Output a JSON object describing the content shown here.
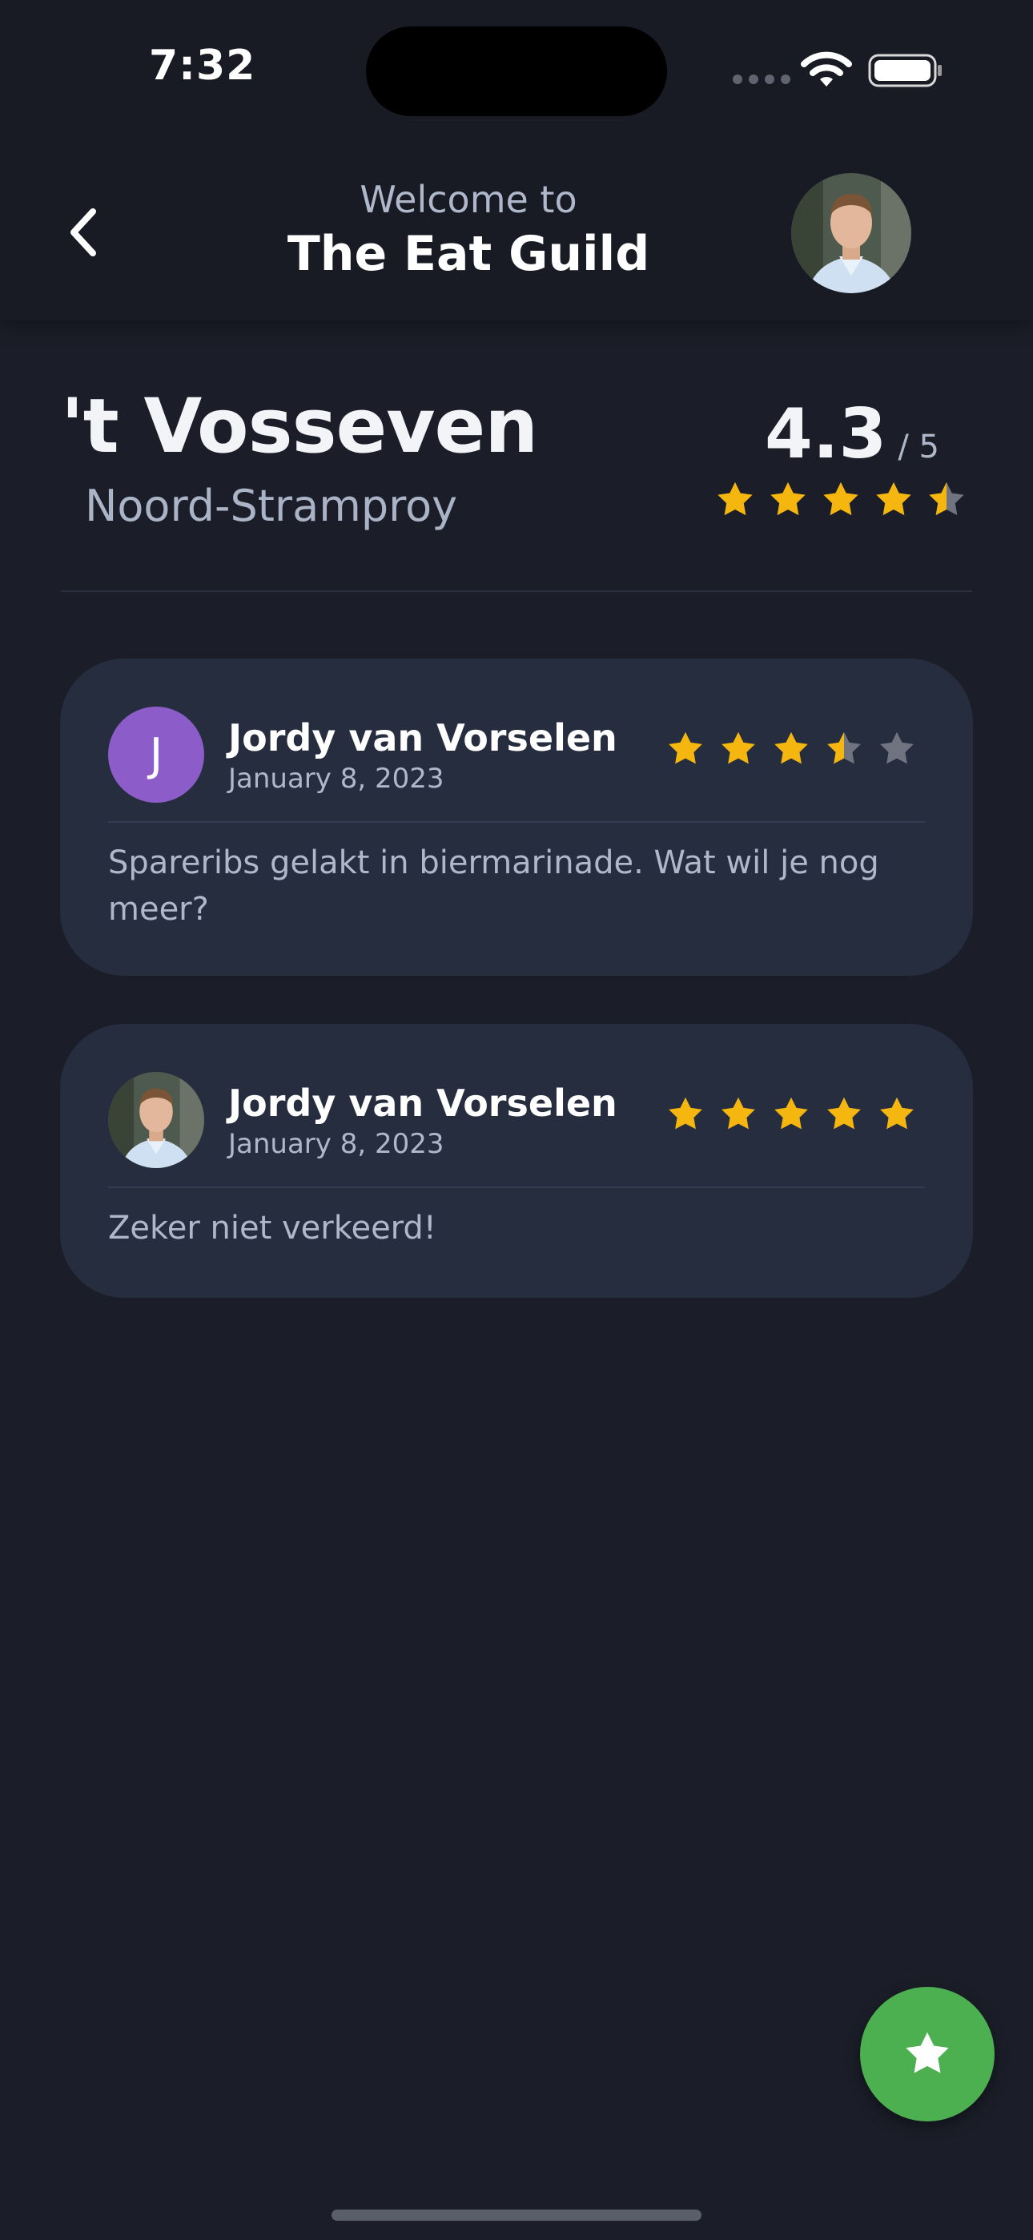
{
  "status_bar": {
    "time": "7:32"
  },
  "header": {
    "welcome_text": "Welcome to",
    "app_name": "The Eat Guild",
    "back_icon": "chevron-left-icon",
    "avatar": "profile-photo"
  },
  "restaurant": {
    "name": "'t Vosseven",
    "city": "Noord-Stramproy",
    "rating": "4.3",
    "rating_max": "/ 5",
    "rating_value": 4.3
  },
  "reviews": [
    {
      "reviewer": "Jordy van Vorselen",
      "date": "January 8, 2023",
      "avatar_initial": "J",
      "rating": 3.5,
      "comment": "Spareribs gelakt in biermarinade. Wat wil je nog meer?"
    },
    {
      "reviewer": "Jordy van Vorselen",
      "date": "January 8, 2023",
      "avatar": "profile-photo",
      "rating": 5,
      "comment": "Zeker niet verkeerd!"
    }
  ],
  "fab": {
    "icon": "star-icon"
  },
  "colors": {
    "background": "#1b1e28",
    "card": "#252d3f",
    "star_filled": "#f5b70f",
    "star_empty": "#6f7480",
    "fab": "#4caf50",
    "avatar_letter_bg": "#8c5cc9"
  }
}
